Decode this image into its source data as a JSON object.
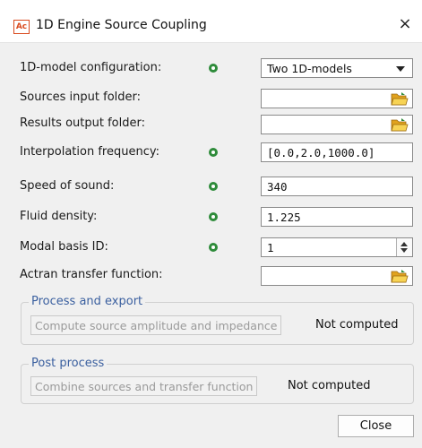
{
  "window": {
    "icon_text": "Ac",
    "title": "1D Engine Source Coupling",
    "close_glyph": "×"
  },
  "form": {
    "model_config": {
      "label": "1D-model configuration:",
      "value": "Two 1D-models"
    },
    "sources_folder": {
      "label": "Sources input folder:",
      "value": ""
    },
    "results_folder": {
      "label": "Results output folder:",
      "value": ""
    },
    "interp_freq": {
      "label": "Interpolation frequency:",
      "value": "[0.0,2.0,1000.0]"
    },
    "speed_sound": {
      "label": "Speed of sound:",
      "value": "340"
    },
    "fluid_density": {
      "label": "Fluid density:",
      "value": "1.225"
    },
    "modal_basis": {
      "label": "Modal basis ID:",
      "value": "1"
    },
    "transfer_fn": {
      "label": "Actran transfer function:",
      "value": ""
    }
  },
  "process_export": {
    "title": "Process and export",
    "button": "Compute source amplitude and impedance",
    "status": "Not computed"
  },
  "post_process": {
    "title": "Post process",
    "button": "Combine sources and transfer function",
    "status": "Not computed"
  },
  "footer": {
    "close_label": "Close"
  },
  "colors": {
    "accent_blue": "#3a5f9f",
    "info_green": "#2e8b3a",
    "folder_yellow": "#f2c12e"
  }
}
